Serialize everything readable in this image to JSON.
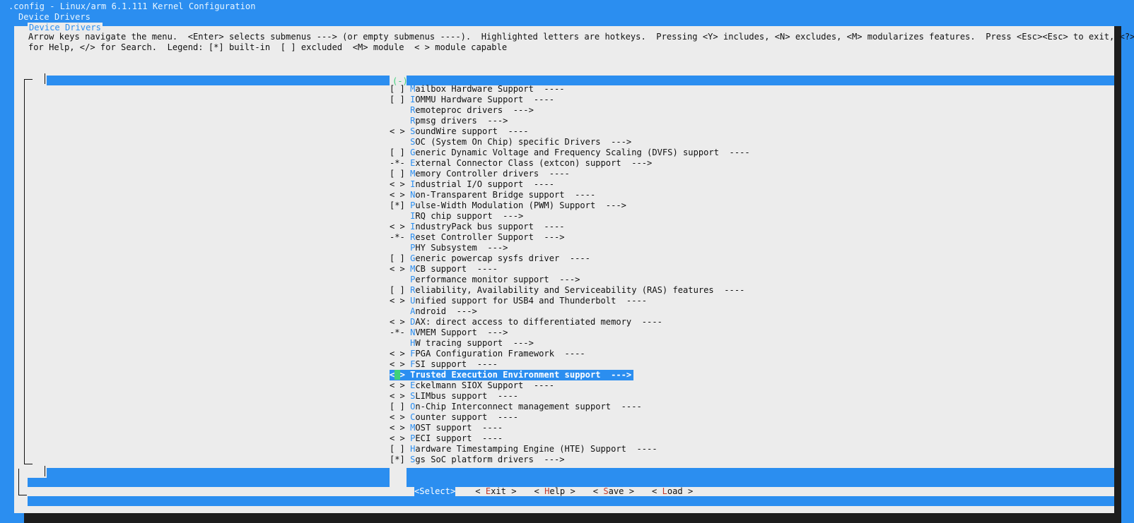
{
  "window": {
    "title": ".config - Linux/arm 6.1.111 Kernel Configuration",
    "breadcrumb": "Device Drivers"
  },
  "dialog": {
    "title": "Device Drivers",
    "help_line_1": "Arrow keys navigate the menu.  <Enter> selects submenus ---> (or empty submenus ----).  Highlighted letters are hotkeys.  Pressing <Y> includes, <N> excludes, <M> modularizes features.  Press <Esc><Esc> to exit, <?>",
    "help_line_2": "for Help, </> for Search.  Legend: [*] built-in  [ ] excluded  <M> module  < > module capable",
    "scroll_indicator": "(-)"
  },
  "menu": {
    "items": [
      {
        "prefix": "[ ] ",
        "hotkey": "M",
        "rest": "ailbox Hardware Support  ----"
      },
      {
        "prefix": "[ ] ",
        "hotkey": "I",
        "rest": "OMMU Hardware Support  ----"
      },
      {
        "prefix": "    ",
        "hotkey": "R",
        "rest": "emoteproc drivers  --->"
      },
      {
        "prefix": "    ",
        "hotkey": "R",
        "rest": "pmsg drivers  --->"
      },
      {
        "prefix": "< > ",
        "hotkey": "S",
        "rest": "oundWire support  ----"
      },
      {
        "prefix": "    ",
        "hotkey": "S",
        "rest": "OC (System On Chip) specific Drivers  --->"
      },
      {
        "prefix": "[ ] ",
        "hotkey": "G",
        "rest": "eneric Dynamic Voltage and Frequency Scaling (DVFS) support  ----"
      },
      {
        "prefix": "-*- ",
        "hotkey": "E",
        "rest": "xternal Connector Class (extcon) support  --->"
      },
      {
        "prefix": "[ ] ",
        "hotkey": "M",
        "rest": "emory Controller drivers  ----"
      },
      {
        "prefix": "< > ",
        "hotkey": "I",
        "rest": "ndustrial I/O support  ----"
      },
      {
        "prefix": "< > ",
        "hotkey": "N",
        "rest": "on-Transparent Bridge support  ----"
      },
      {
        "prefix": "[*] ",
        "hotkey": "P",
        "rest": "ulse-Width Modulation (PWM) Support  --->"
      },
      {
        "prefix": "    ",
        "hotkey": "I",
        "rest": "RQ chip support  --->"
      },
      {
        "prefix": "< > ",
        "hotkey": "I",
        "rest": "ndustryPack bus support  ----"
      },
      {
        "prefix": "-*- ",
        "hotkey": "R",
        "rest": "eset Controller Support  --->"
      },
      {
        "prefix": "    ",
        "hotkey": "P",
        "rest": "HY Subsystem  --->"
      },
      {
        "prefix": "[ ] ",
        "hotkey": "G",
        "rest": "eneric powercap sysfs driver  ----"
      },
      {
        "prefix": "< > ",
        "hotkey": "M",
        "rest": "CB support  ----"
      },
      {
        "prefix": "    ",
        "hotkey": "P",
        "rest": "erformance monitor support  --->"
      },
      {
        "prefix": "[ ] ",
        "hotkey": "R",
        "rest": "eliability, Availability and Serviceability (RAS) features  ----"
      },
      {
        "prefix": "< > ",
        "hotkey": "U",
        "rest": "nified support for USB4 and Thunderbolt  ----"
      },
      {
        "prefix": "    ",
        "hotkey": "A",
        "rest": "ndroid  --->"
      },
      {
        "prefix": "< > ",
        "hotkey": "D",
        "rest": "AX: direct access to differentiated memory  ----"
      },
      {
        "prefix": "-*- ",
        "hotkey": "N",
        "rest": "VMEM Support  --->"
      },
      {
        "prefix": "    ",
        "hotkey": "H",
        "rest": "W tracing support  --->"
      },
      {
        "prefix": "< > ",
        "hotkey": "F",
        "rest": "PGA Configuration Framework  ----"
      },
      {
        "prefix": "< > ",
        "hotkey": "F",
        "rest": "SI support  ----"
      },
      {
        "prefix": "< > ",
        "hotkey": "T",
        "rest": "rusted Execution Environment support  --->",
        "selected": true
      },
      {
        "prefix": "< > ",
        "hotkey": "E",
        "rest": "ckelmann SIOX Support  ----"
      },
      {
        "prefix": "< > ",
        "hotkey": "S",
        "rest": "LIMbus support  ----"
      },
      {
        "prefix": "[ ] ",
        "hotkey": "O",
        "rest": "n-Chip Interconnect management support  ----"
      },
      {
        "prefix": "< > ",
        "hotkey": "C",
        "rest": "ounter support  ----"
      },
      {
        "prefix": "< > ",
        "hotkey": "M",
        "rest": "OST support  ----"
      },
      {
        "prefix": "< > ",
        "hotkey": "P",
        "rest": "ECI support  ----"
      },
      {
        "prefix": "[ ] ",
        "hotkey": "H",
        "rest": "ardware Timestamping Engine (HTE) Support  ----"
      },
      {
        "prefix": "[*] ",
        "hotkey": "S",
        "rest": "gs SoC platform drivers  --->"
      }
    ]
  },
  "buttons": [
    {
      "left": "<",
      "hotkey": "S",
      "rest": "elect",
      "right": ">",
      "selected": true
    },
    {
      "left": "< ",
      "hotkey": "E",
      "rest": "xit",
      "right": " >"
    },
    {
      "left": "< ",
      "hotkey": "H",
      "rest": "elp",
      "right": " >"
    },
    {
      "left": "< ",
      "hotkey": "S",
      "rest": "ave",
      "right": " >"
    },
    {
      "left": "< ",
      "hotkey": "L",
      "rest": "oad",
      "right": " >"
    }
  ],
  "colors": {
    "background": "#2b8ef0",
    "dialog": "#ececec",
    "hotkey": "#2b8ef0",
    "button_hotkey": "#c0392b",
    "cursor": "#3fd17a",
    "shadow": "#1d1d1d"
  }
}
